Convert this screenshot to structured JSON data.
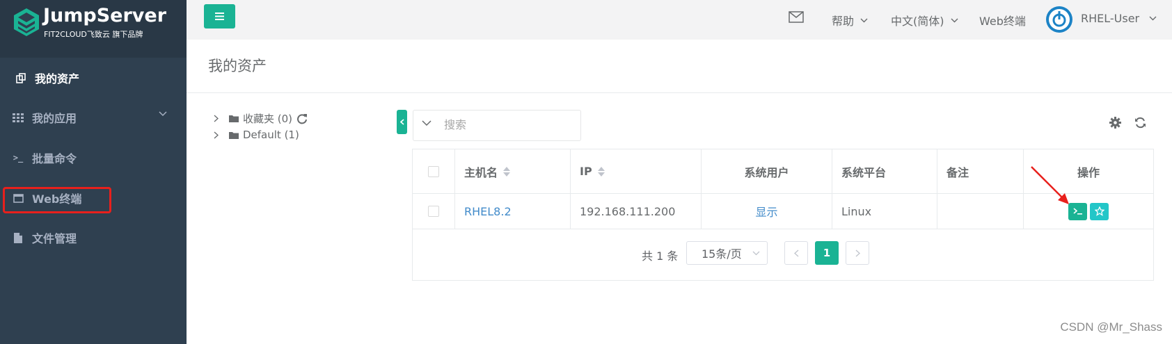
{
  "brand": {
    "title": "JumpServer",
    "subtitle": "FIT2CLOUD飞致云 旗下品牌"
  },
  "sidebar": {
    "items": [
      {
        "label": "我的资产",
        "icon": "assets-icon"
      },
      {
        "label": "我的应用",
        "icon": "grid-icon"
      },
      {
        "label": "批量命令",
        "icon": "terminal-prompt-icon"
      },
      {
        "label": "Web终端",
        "icon": "window-icon"
      },
      {
        "label": "文件管理",
        "icon": "file-icon"
      }
    ]
  },
  "topbar": {
    "help": "帮助",
    "language": "中文(简体)",
    "web_terminal": "Web终端",
    "user": "RHEL-User"
  },
  "page": {
    "title": "我的资产"
  },
  "tree": {
    "nodes": [
      {
        "label": "收藏夹 (0)"
      },
      {
        "label": "Default (1)"
      }
    ]
  },
  "search": {
    "placeholder": "搜索"
  },
  "table": {
    "headers": {
      "hostname": "主机名",
      "ip": "IP",
      "system_user": "系统用户",
      "platform": "系统平台",
      "comment": "备注",
      "actions": "操作"
    },
    "rows": [
      {
        "hostname": "RHEL8.2",
        "ip": "192.168.111.200",
        "system_user": "显示",
        "platform": "Linux",
        "comment": ""
      }
    ]
  },
  "pagination": {
    "total": "共 1 条",
    "page_size": "15条/页",
    "current_page": "1"
  },
  "watermark": "CSDN @Mr_Shass",
  "colors": {
    "sidebar": "#2f4050",
    "accent": "#1ab394",
    "star": "#23c6c8",
    "link": "#428bca",
    "highlight": "#e8201c"
  }
}
